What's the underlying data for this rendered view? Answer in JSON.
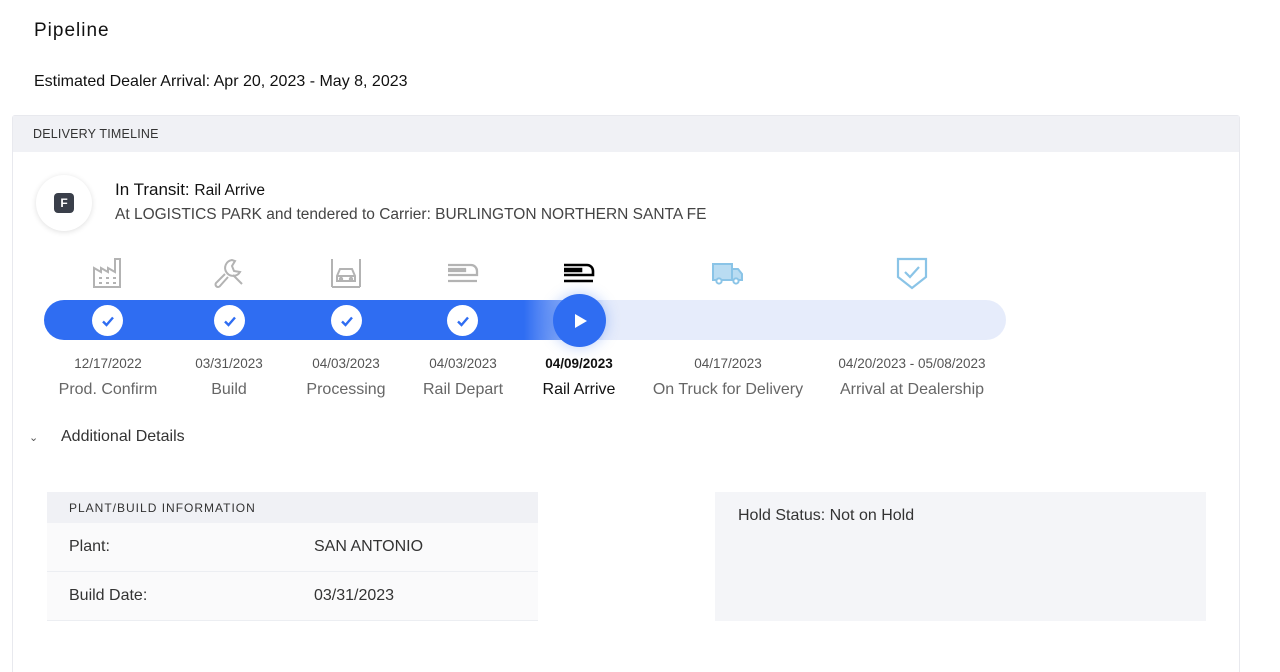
{
  "page": {
    "title": "Pipeline",
    "eta_label": "Estimated Dealer Arrival:",
    "eta_value": "Apr 20, 2023 - May 8, 2023"
  },
  "timeline": {
    "header": "DELIVERY TIMELINE",
    "badge_letter": "F",
    "status_prefix": "In Transit:",
    "status_stage": "Rail Arrive",
    "status_detail": "At LOGISTICS PARK and tendered to Carrier: BURLINGTON NORTHERN SANTA FE",
    "current_stage_index": 4,
    "progress_color": "#2f6df2",
    "stages": [
      {
        "date": "12/17/2022",
        "label": "Prod. Confirm",
        "icon": "factory-icon",
        "state": "complete"
      },
      {
        "date": "03/31/2023",
        "label": "Build",
        "icon": "wrench-icon",
        "state": "complete"
      },
      {
        "date": "04/03/2023",
        "label": "Processing",
        "icon": "car-bay-icon",
        "state": "complete"
      },
      {
        "date": "04/03/2023",
        "label": "Rail Depart",
        "icon": "train-icon",
        "state": "complete"
      },
      {
        "date": "04/09/2023",
        "label": "Rail Arrive",
        "icon": "train-icon",
        "state": "current"
      },
      {
        "date": "04/17/2023",
        "label": "On Truck for Delivery",
        "icon": "truck-icon",
        "state": "upcoming"
      },
      {
        "date": "04/20/2023 - 05/08/2023",
        "label": "Arrival at Dealership",
        "icon": "shield-check-icon",
        "state": "upcoming"
      }
    ]
  },
  "details": {
    "toggle_label": "Additional Details",
    "plant_header": "PLANT/BUILD INFORMATION",
    "plant_rows": [
      {
        "key": "Plant:",
        "value": "SAN ANTONIO"
      },
      {
        "key": "Build Date:",
        "value": "03/31/2023"
      }
    ],
    "hold_status": "Hold Status: Not on Hold"
  }
}
